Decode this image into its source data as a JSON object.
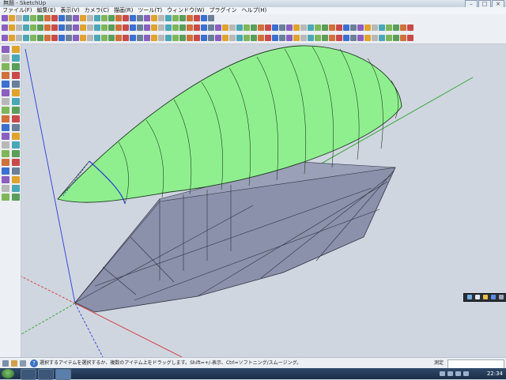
{
  "window": {
    "title": "無題 - SketchUp"
  },
  "window_buttons": [
    "–",
    "□",
    "×"
  ],
  "menu": {
    "items": [
      "ファイル(F)",
      "編集(E)",
      "表示(V)",
      "カメラ(C)",
      "描画(R)",
      "ツール(T)",
      "ウィンドウ(W)",
      "プラグイン",
      "ヘルプ(H)"
    ]
  },
  "toolbar_rows": {
    "row1_count": 30,
    "row2_count": 58,
    "row3_count": 58
  },
  "left_toolbar": {
    "count": 36
  },
  "colors": {
    "canvas_bg": "#cfd6e0",
    "hull_top": "#8fef8f",
    "hull_bottom": "#8b91ab",
    "axis_red": "#d24a4a",
    "axis_green": "#3aa83a",
    "axis_blue": "#3b4bd6"
  },
  "status": {
    "message": "選択するアイテムを選択するか、複数のアイテム上をドラッグします。Shift=+/-表示、Ctrl=ソフトニング/スムージング。",
    "measure_label": "測定",
    "measure_value": ""
  },
  "taskbar": {
    "time": "22:34"
  }
}
